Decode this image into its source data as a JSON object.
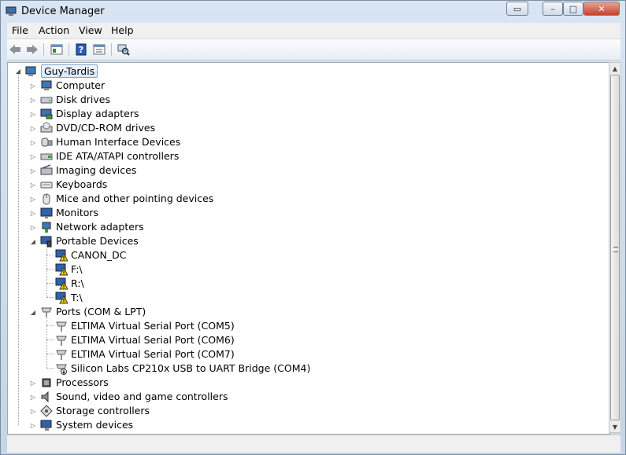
{
  "window": {
    "title": "Device Manager"
  },
  "menu": {
    "file": "File",
    "action": "Action",
    "view": "View",
    "help": "Help"
  },
  "toolbar": {
    "back": "back-arrow-icon",
    "forward": "forward-arrow-icon",
    "show_hide_console": "console-tree-icon",
    "help": "help-icon",
    "properties": "properties-icon",
    "scan": "scan-hardware-icon"
  },
  "tree": {
    "root": {
      "label": "Guy-Tardis",
      "icon": "computer-icon"
    },
    "categories": [
      {
        "label": "Computer",
        "icon": "computer-icon",
        "expanded": false
      },
      {
        "label": "Disk drives",
        "icon": "disk-drive-icon",
        "expanded": false
      },
      {
        "label": "Display adapters",
        "icon": "display-adapter-icon",
        "expanded": false
      },
      {
        "label": "DVD/CD-ROM drives",
        "icon": "dvd-drive-icon",
        "expanded": false
      },
      {
        "label": "Human Interface Devices",
        "icon": "hid-icon",
        "expanded": false
      },
      {
        "label": "IDE ATA/ATAPI controllers",
        "icon": "ide-controller-icon",
        "expanded": false
      },
      {
        "label": "Imaging devices",
        "icon": "imaging-device-icon",
        "expanded": false
      },
      {
        "label": "Keyboards",
        "icon": "keyboard-icon",
        "expanded": false
      },
      {
        "label": "Mice and other pointing devices",
        "icon": "mouse-icon",
        "expanded": false
      },
      {
        "label": "Monitors",
        "icon": "monitor-icon",
        "expanded": false
      },
      {
        "label": "Network adapters",
        "icon": "network-adapter-icon",
        "expanded": false
      },
      {
        "label": "Portable Devices",
        "icon": "portable-device-icon",
        "expanded": true,
        "children": [
          {
            "label": "CANON_DC",
            "icon": "warning-device-icon"
          },
          {
            "label": "F:\\",
            "icon": "warning-device-icon"
          },
          {
            "label": "R:\\",
            "icon": "warning-device-icon"
          },
          {
            "label": "T:\\",
            "icon": "warning-device-icon"
          }
        ]
      },
      {
        "label": "Ports (COM & LPT)",
        "icon": "port-icon",
        "expanded": true,
        "children": [
          {
            "label": "ELTIMA Virtual Serial Port (COM5)",
            "icon": "port-icon"
          },
          {
            "label": "ELTIMA Virtual Serial Port (COM6)",
            "icon": "port-icon"
          },
          {
            "label": "ELTIMA Virtual Serial Port (COM7)",
            "icon": "port-icon"
          },
          {
            "label": "Silicon Labs CP210x USB to UART Bridge (COM4)",
            "icon": "port-disabled-icon"
          }
        ]
      },
      {
        "label": "Processors",
        "icon": "processor-icon",
        "expanded": false
      },
      {
        "label": "Sound, video and game controllers",
        "icon": "sound-icon",
        "expanded": false
      },
      {
        "label": "Storage controllers",
        "icon": "storage-controller-icon",
        "expanded": false
      },
      {
        "label": "System devices",
        "icon": "system-device-icon",
        "expanded": false
      }
    ]
  },
  "colors": {
    "selection_border": "#7da2ce",
    "warning": "#f5d000",
    "tree_bg": "#ffffff"
  }
}
